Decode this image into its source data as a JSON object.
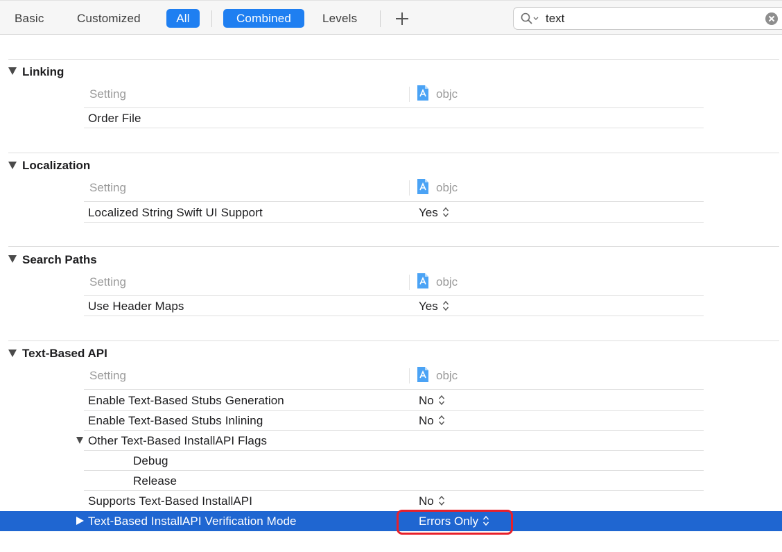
{
  "toolbar": {
    "basic": "Basic",
    "customized": "Customized",
    "all": "All",
    "combined": "Combined",
    "levels": "Levels",
    "add_icon": "plus-icon"
  },
  "search": {
    "value": "text",
    "icon": "magnifier-icon",
    "clear_icon": "clear-icon"
  },
  "header": {
    "setting": "Setting",
    "target": "objc"
  },
  "sections": {
    "linking": {
      "title": "Linking",
      "rows": [
        {
          "label": "Order File",
          "value": ""
        }
      ]
    },
    "localization": {
      "title": "Localization",
      "rows": [
        {
          "label": "Localized String Swift UI Support",
          "value": "Yes"
        }
      ]
    },
    "search_paths": {
      "title": "Search Paths",
      "rows": [
        {
          "label": "Use Header Maps",
          "value": "Yes"
        }
      ]
    },
    "text_based_api": {
      "title": "Text-Based API",
      "rows": [
        {
          "label": "Enable Text-Based Stubs Generation",
          "value": "No"
        },
        {
          "label": "Enable Text-Based Stubs Inlining",
          "value": "No"
        },
        {
          "label": "Other Text-Based InstallAPI Flags",
          "value": ""
        },
        {
          "label": "Debug",
          "value": ""
        },
        {
          "label": "Release",
          "value": ""
        },
        {
          "label": "Supports Text-Based InstallAPI",
          "value": "No"
        },
        {
          "label": "Text-Based InstallAPI Verification Mode",
          "value": "Errors Only"
        }
      ]
    }
  },
  "colors": {
    "accent": "#1f7ff1",
    "selection": "#1f66d1",
    "annotation": "#e8202a"
  }
}
